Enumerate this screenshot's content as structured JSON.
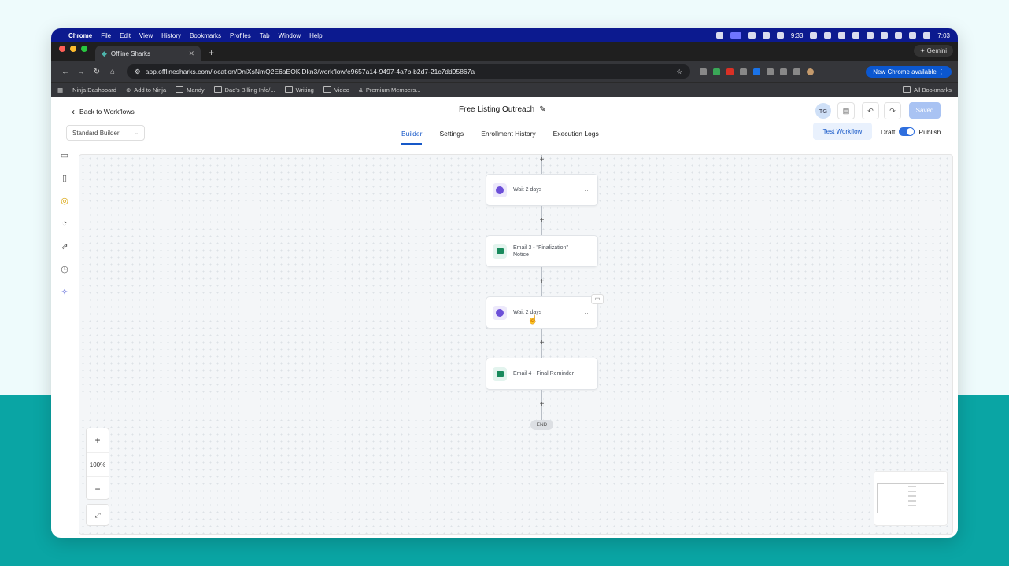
{
  "menubar": {
    "items": [
      "Chrome",
      "File",
      "Edit",
      "View",
      "History",
      "Bookmarks",
      "Profiles",
      "Tab",
      "Window",
      "Help"
    ],
    "battery_time": "9:33",
    "clock": "7:03"
  },
  "browser": {
    "tab_title": "Offline Sharks",
    "url": "app.offlinesharks.com/location/DniXsNmQ2E6aEOKlDkn3/workflow/e9657a14-9497-4a7b-b2d7-21c7dd95867a",
    "gemini_label": "Gemini",
    "new_chrome_label": "New Chrome available",
    "bookmarks": [
      "Ninja Dashboard",
      "Add to Ninja",
      "Mandy",
      "Dad's Billing Info/...",
      "Writing",
      "Video",
      "Premium Members..."
    ],
    "all_bookmarks": "All Bookmarks"
  },
  "app": {
    "back_label": "Back to Workflows",
    "workflow_title": "Free Listing Outreach",
    "avatar_initials": "TG",
    "saved_label": "Saved",
    "builder_select": "Standard Builder",
    "tabs": [
      "Builder",
      "Settings",
      "Enrollment History",
      "Execution Logs"
    ],
    "active_tab": "Builder",
    "test_workflow_label": "Test Workflow",
    "draft_label": "Draft",
    "publish_label": "Publish",
    "publish_enabled": true
  },
  "canvas": {
    "nodes": [
      {
        "type": "wait",
        "icon": "clock-icon",
        "label": "Wait 2 days"
      },
      {
        "type": "email",
        "icon": "mail-icon",
        "label": "Email 3 - \"Finalization\" Notice"
      },
      {
        "type": "wait",
        "icon": "clock-icon",
        "label": "Wait 2 days"
      },
      {
        "type": "email",
        "icon": "mail-icon",
        "label": "Email 4 - Final Reminder"
      }
    ],
    "end_label": "END",
    "zoom_level": "100%"
  },
  "colors": {
    "accent": "#1658c8",
    "saved_button": "#a9c3f3",
    "wait_icon": "#6c4fd8",
    "email_icon": "#188a5c",
    "menubar": "#0c1a8f",
    "background_teal": "#0aa5a4"
  }
}
